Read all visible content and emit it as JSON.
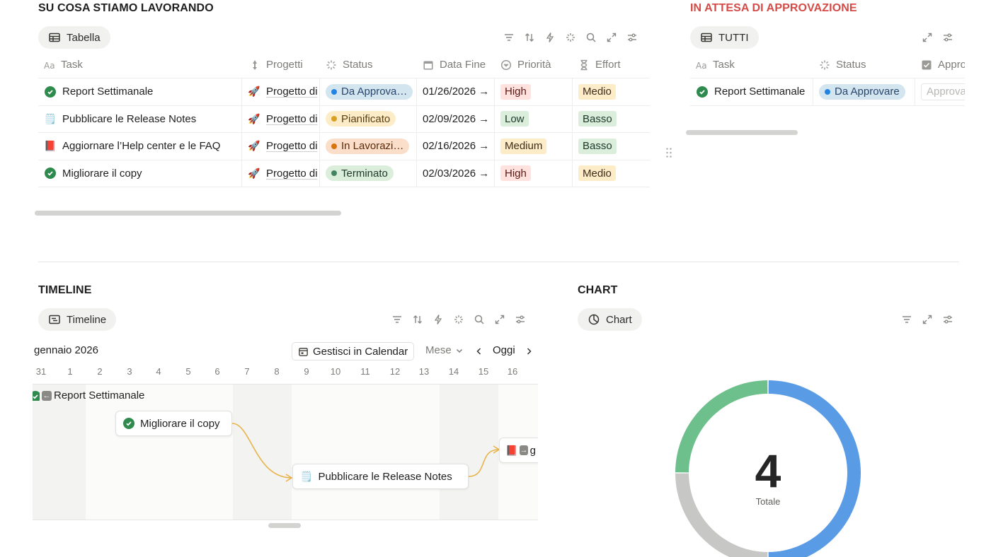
{
  "top_left": {
    "title": "SU COSA STIAMO LAVORANDO",
    "view_label": "Tabella",
    "columns": [
      "Task",
      "Progetti",
      "Status",
      "Data Fine",
      "Priorità",
      "Effort"
    ],
    "rows": [
      {
        "icon": "check-circle-icon",
        "task": "Report Settimanale",
        "project": "Progetto di",
        "status": "Da Approva…",
        "status_color": "#2383e2",
        "status_bg": "#d3e5ef",
        "date": "01/26/2026 →",
        "priority": "High",
        "priority_bg": "#ffe2dd",
        "priority_fg": "#5d1715",
        "effort": "Medio",
        "effort_bg": "#fdecc8"
      },
      {
        "icon": "memo-icon",
        "task": "Pubblicare le Release Notes",
        "project": "Progetto di",
        "status": "Pianificato",
        "status_color": "#d9a023",
        "status_bg": "#fdecc8",
        "date": "02/09/2026 →",
        "priority": "Low",
        "priority_bg": "#dbeddb",
        "priority_fg": "#1c3829",
        "effort": "Basso",
        "effort_bg": "#dbeddb"
      },
      {
        "icon": "book-icon",
        "task": "Aggiornare l’Help center e le FAQ",
        "project": "Progetto di",
        "status": "In Lavorazi…",
        "status_color": "#d9730d",
        "status_bg": "#fadec9",
        "date": "02/16/2026 →",
        "priority": "Medium",
        "priority_bg": "#fdecc8",
        "priority_fg": "#402c1b",
        "effort": "Basso",
        "effort_bg": "#dbeddb"
      },
      {
        "icon": "check-circle-icon",
        "task": "Migliorare il copy",
        "project": "Progetto di",
        "status": "Terminato",
        "status_color": "#448361",
        "status_bg": "#dbeddb",
        "date": "02/03/2026 →",
        "priority": "High",
        "priority_bg": "#ffe2dd",
        "priority_fg": "#5d1715",
        "effort": "Medio",
        "effort_bg": "#fdecc8"
      }
    ]
  },
  "top_right": {
    "title": "IN ATTESA DI APPROVAZIONE",
    "view_label": "TUTTI",
    "columns": [
      "Task",
      "Status",
      "Appro"
    ],
    "rows": [
      {
        "task": "Report Settimanale",
        "status": "Da Approvare",
        "approve": "Approva"
      }
    ]
  },
  "timeline": {
    "title": "TIMELINE",
    "view_label": "Timeline",
    "month": "gennaio 2026",
    "calendar_button": "Gestisci in Calendar",
    "range_select": "Mese",
    "today_button": "Oggi",
    "days": [
      "31",
      "1",
      "2",
      "3",
      "4",
      "5",
      "6",
      "7",
      "8",
      "9",
      "10",
      "11",
      "12",
      "13",
      "14",
      "15",
      "16"
    ],
    "items": [
      {
        "label": "Report Settimanale"
      },
      {
        "label": "Migliorare il copy"
      },
      {
        "label": "Pubblicare le Release Notes"
      },
      {
        "label": "g"
      }
    ],
    "link_color": "#e8b34a"
  },
  "chart": {
    "title": "CHART",
    "view_label": "Chart",
    "chart_data": {
      "type": "pie",
      "style": "donut",
      "total_label": "4",
      "total_caption": "Totale",
      "values": [
        2,
        1,
        1
      ],
      "colors": [
        "#5a9be6",
        "#c7c7c5",
        "#6dbf8b"
      ]
    }
  }
}
